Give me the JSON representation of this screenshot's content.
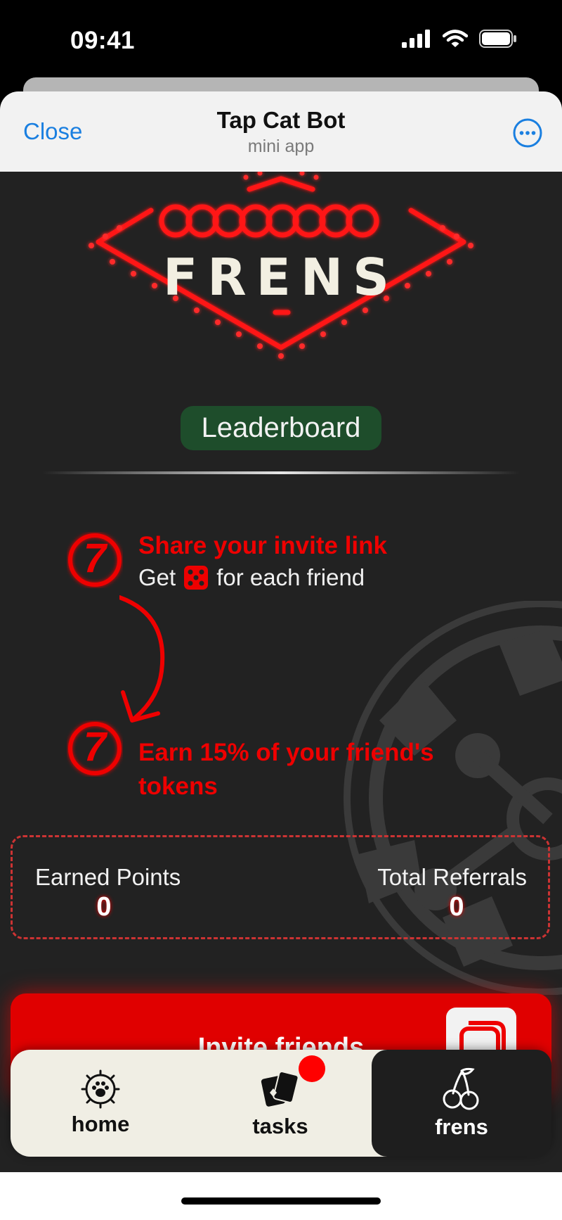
{
  "status_bar": {
    "time": "09:41",
    "icons": [
      "signal-icon",
      "wifi-icon",
      "battery-icon"
    ]
  },
  "header": {
    "close_label": "Close",
    "title": "Tap Cat Bot",
    "subtitle": "mini app",
    "more_icon": "more-options-icon"
  },
  "hero": {
    "title": "FRENS"
  },
  "leaderboard": {
    "label": "Leaderboard",
    "color": "#1e4d2b"
  },
  "steps": [
    {
      "badge": "7",
      "title": "Share your invite link",
      "sub_prefix": "Get",
      "sub_icon": "dice-icon",
      "sub_suffix": "for each friend"
    },
    {
      "badge": "7",
      "title": "Earn 15% of your friend's tokens"
    }
  ],
  "stats": {
    "earned_label": "Earned Points",
    "earned_value": "0",
    "referrals_label": "Total Referrals",
    "referrals_value": "0"
  },
  "invite": {
    "label": "Invite friends",
    "copy_icon": "copy-icon"
  },
  "nav": {
    "items": [
      {
        "label": "home",
        "icon": "paw-icon"
      },
      {
        "label": "tasks",
        "icon": "cards-icon"
      },
      {
        "label": "frens",
        "icon": "cherries-icon",
        "active": true
      }
    ]
  },
  "colors": {
    "accent": "#e00000",
    "background": "#222222",
    "header_link": "#1a7fe0"
  }
}
